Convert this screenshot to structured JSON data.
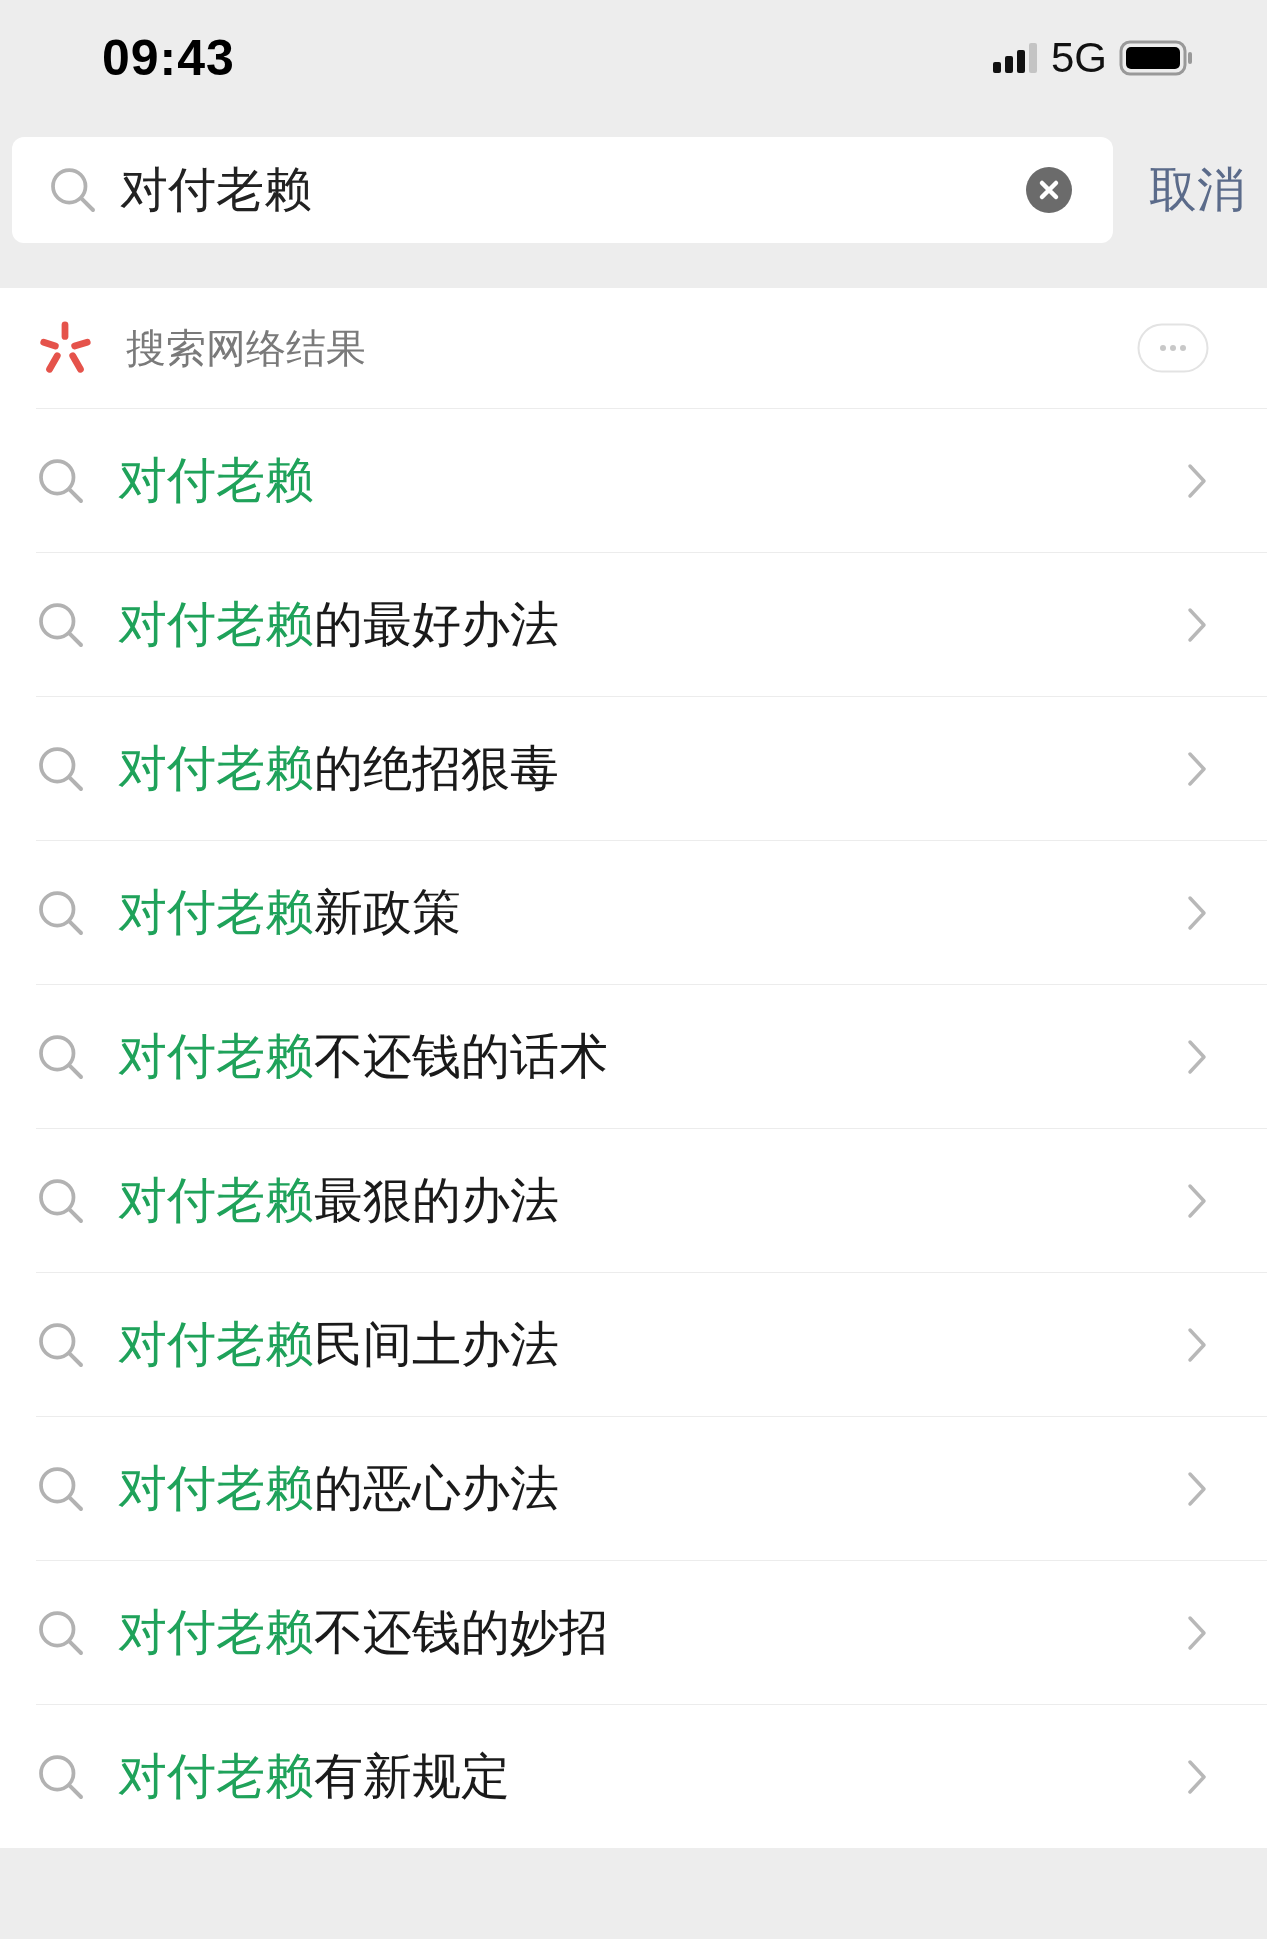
{
  "status_bar": {
    "time": "09:43",
    "network": "5G"
  },
  "search": {
    "value": "对付老赖",
    "cancel": "取消"
  },
  "section": {
    "title": "搜索网络结果"
  },
  "suggestions": [
    {
      "match": "对付老赖"
    },
    {
      "match": "对付老赖",
      "rest": "的最好办法"
    },
    {
      "match": "对付老赖",
      "rest": "的绝招狠毒"
    },
    {
      "match": "对付老赖",
      "rest": "新政策"
    },
    {
      "match": "对付老赖",
      "rest": "不还钱的话术"
    },
    {
      "match": "对付老赖",
      "rest": "最狠的办法"
    },
    {
      "match": "对付老赖",
      "rest": "民间土办法"
    },
    {
      "match": "对付老赖",
      "rest": "的恶心办法"
    },
    {
      "match": "对付老赖",
      "rest": "不还钱的妙招"
    },
    {
      "match": "对付老赖",
      "rest": "有新规定"
    }
  ]
}
